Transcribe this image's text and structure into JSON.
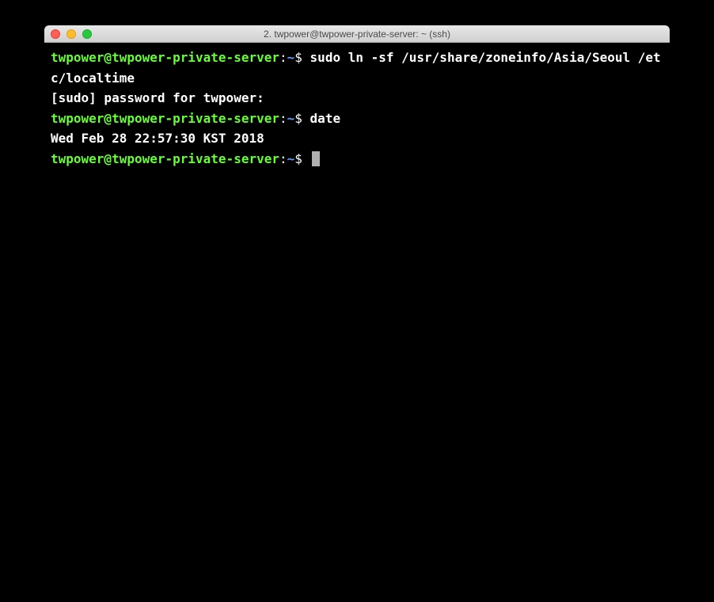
{
  "window": {
    "title": "2. twpower@twpower-private-server: ~ (ssh)"
  },
  "colors": {
    "prompt_user": "#66ff33",
    "prompt_path": "#5c9eff",
    "background": "#000000",
    "foreground": "#ffffff"
  },
  "prompt": {
    "userhost": "twpower@twpower-private-server",
    "separator": ":",
    "path": "~",
    "symbol": "$"
  },
  "lines": [
    {
      "type": "command",
      "command": "sudo ln -sf /usr/share/zoneinfo/Asia/Seoul /etc/localtime"
    },
    {
      "type": "output",
      "text": "[sudo] password for twpower:"
    },
    {
      "type": "command",
      "command": "date"
    },
    {
      "type": "output",
      "text": "Wed Feb 28 22:57:30 KST 2018"
    },
    {
      "type": "prompt-cursor"
    }
  ]
}
